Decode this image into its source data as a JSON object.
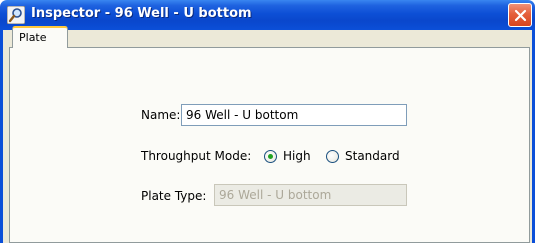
{
  "window": {
    "title": "Inspector - 96 Well - U bottom",
    "title_bar_color": "#0b4fd8",
    "close_button_color": "#d8451f"
  },
  "tabs": [
    {
      "label": "Plate",
      "selected": true
    }
  ],
  "form": {
    "name_label": "Name:",
    "name_value": "96 Well - U bottom",
    "throughput_label": "Throughput Mode:",
    "throughput_options": [
      {
        "label": "High",
        "checked": true
      },
      {
        "label": "Standard",
        "checked": false
      }
    ],
    "plate_type_label": "Plate Type:",
    "plate_type_value": "96 Well - U bottom",
    "plate_type_disabled": true
  },
  "icons": {
    "app_icon": "magnifier-icon",
    "close_icon": "close-icon"
  }
}
